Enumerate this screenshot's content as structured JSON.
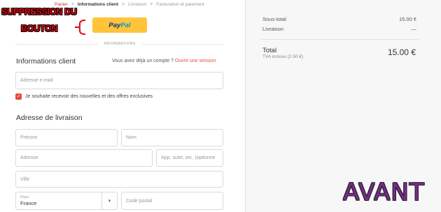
{
  "breadcrumb": {
    "cart": "Panier",
    "sep": ">",
    "client": "Informations client",
    "shipping": "Livraison",
    "billing": "Facturation et paiement"
  },
  "annotation": {
    "line1": "SUPPRESSION DU",
    "line2": "BOUTON",
    "color": "#e30613",
    "stamp": "AVANT",
    "stamp_color": "#7a2a8c"
  },
  "paypal": {
    "part1": "Pay",
    "part2": "Pal",
    "color": "#ffc439"
  },
  "divider_label": "INFORMATIONS",
  "client_section": {
    "title": "Informations client",
    "login_prompt": "Vous avez déjà un compte ?",
    "login_link": "Ouvrir une session",
    "email_placeholder": "Adresse e-mail",
    "newsletter_label": "Je souhaite recevoir des nouvelles et des offres exclusives",
    "newsletter_checked": true,
    "accent_color": "#e74c3c"
  },
  "shipping_section": {
    "title": "Adresse de livraison",
    "firstname_placeholder": "Prénom",
    "lastname_placeholder": "Nom",
    "address_placeholder": "Adresse",
    "address2_placeholder": "App, suite, etc. (optionne",
    "city_placeholder": "Ville",
    "country_label": "Pays",
    "country_value": "France",
    "postal_placeholder": "Code postal"
  },
  "summary": {
    "subtotal_label": "Sous-total",
    "subtotal_value": "15.00 €",
    "shipping_label": "Livraison",
    "shipping_value": "—",
    "total_label": "Total",
    "tax_label": "TVA incluse (2.50 €)",
    "total_value": "15.00 €"
  },
  "icons": {
    "checkbox": "checkmark-icon",
    "select": "chevron-down-icon"
  }
}
